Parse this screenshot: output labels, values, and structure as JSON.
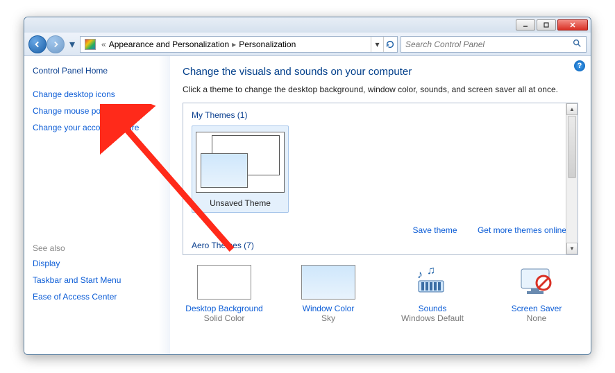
{
  "breadcrumb": {
    "part1": "Appearance and Personalization",
    "part2": "Personalization"
  },
  "search": {
    "placeholder": "Search Control Panel"
  },
  "sidebar": {
    "home": "Control Panel Home",
    "links": [
      "Change desktop icons",
      "Change mouse pointers",
      "Change your account picture"
    ],
    "see_also_label": "See also",
    "see_also": [
      "Display",
      "Taskbar and Start Menu",
      "Ease of Access Center"
    ]
  },
  "main": {
    "title": "Change the visuals and sounds on your computer",
    "subtitle": "Click a theme to change the desktop background, window color, sounds, and screen saver all at once.",
    "my_themes_label": "My Themes (1)",
    "theme_name": "Unsaved Theme",
    "save_theme": "Save theme",
    "get_more": "Get more themes online",
    "aero_label": "Aero Themes (7)"
  },
  "bottom": {
    "items": [
      {
        "label": "Desktop Background",
        "sub": "Solid Color"
      },
      {
        "label": "Window Color",
        "sub": "Sky"
      },
      {
        "label": "Sounds",
        "sub": "Windows Default"
      },
      {
        "label": "Screen Saver",
        "sub": "None"
      }
    ]
  }
}
